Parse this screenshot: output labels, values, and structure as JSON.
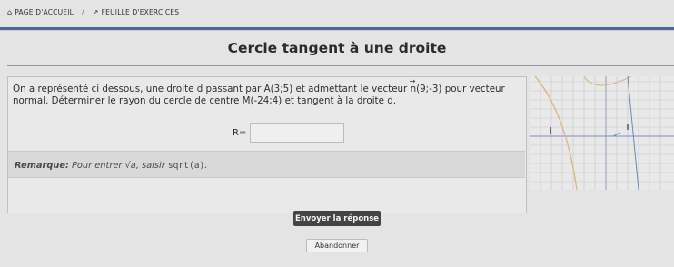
{
  "breadcrumb": {
    "home_icon": "home-icon",
    "home_label": "PAGE D'ACCUEIL",
    "separator": "/",
    "sheet_icon": "external-link-icon",
    "sheet_label": "FEUILLE D'EXERCICES"
  },
  "exercise": {
    "title": "Cercle tangent à une droite",
    "q_part1": "On a représenté ci dessous, une droite d passant par A(3;5) et admettant le vecteur ",
    "q_vec": "n",
    "q_part2": "(9;-3) pour vecteur",
    "q_line2": "normal. Déterminer le rayon du cercle de centre M(-24;4) et tangent à la droite d."
  },
  "answer": {
    "label": "R=",
    "value": ""
  },
  "remark": {
    "prefix": "Remarque:",
    "text1": " Pour entrer ",
    "sqrt_symbol": "√a",
    "text2": ", saisir ",
    "code": "sqrt(a)",
    "suffix": "."
  },
  "buttons": {
    "submit": "Envoyer la réponse",
    "abandon": "Abandonner"
  },
  "colors": {
    "accent_line": "#4a6a9a",
    "curve": "#d9b98a",
    "graph_line": "#6a8ab8",
    "submit_bg": "#444444"
  }
}
